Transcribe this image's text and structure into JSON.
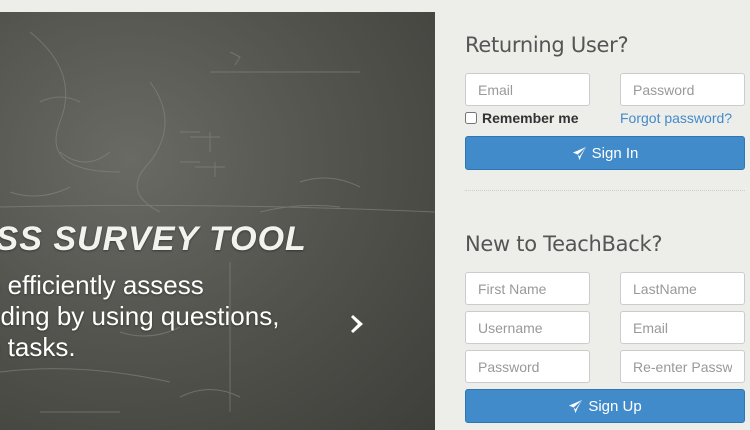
{
  "hero": {
    "title": "ASS SURVEY TOOL",
    "lines": [
      "o efficiently assess",
      "nding by using questions,",
      "p tasks."
    ],
    "next_icon": "chevron-right-icon"
  },
  "login": {
    "heading": "Returning User?",
    "email_placeholder": "Email",
    "password_placeholder": "Password",
    "remember_label": "Remember me",
    "forgot_label": "Forgot password?",
    "signin_label": "Sign In",
    "signin_icon": "paper-plane-icon"
  },
  "signup": {
    "heading": "New to TeachBack?",
    "first_name_placeholder": "First Name",
    "last_name_placeholder": "LastName",
    "username_placeholder": "Username",
    "email_placeholder": "Email",
    "password_placeholder": "Password",
    "reenter_placeholder": "Re-enter Password",
    "signup_label": "Sign Up",
    "signup_icon": "paper-plane-icon"
  },
  "colors": {
    "accent": "#428bca",
    "background": "#ededea",
    "chalkboard": "#55554f"
  }
}
